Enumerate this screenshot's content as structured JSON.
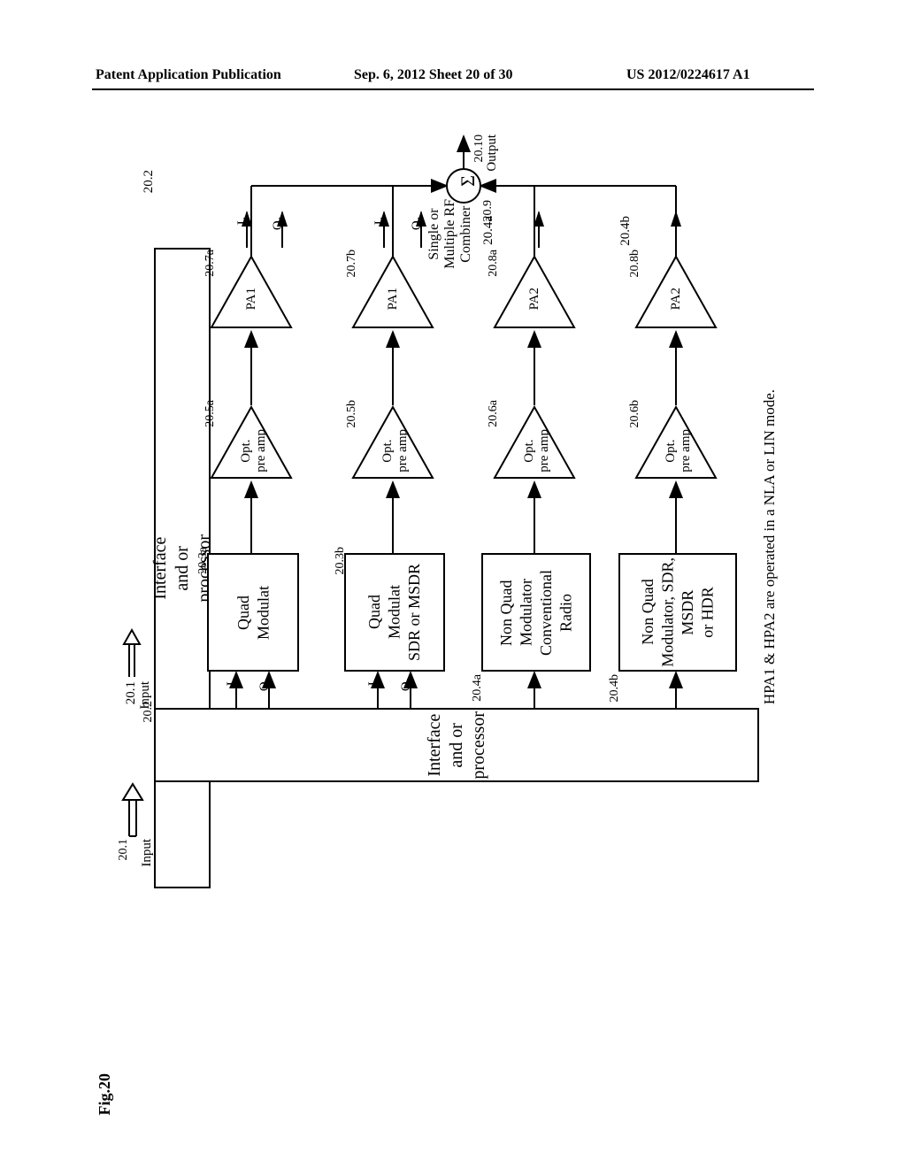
{
  "header": {
    "left": "Patent Application Publication",
    "center": "Sep. 6, 2012  Sheet 20 of 30",
    "right": "US 2012/0224617 A1"
  },
  "input": {
    "ref": "20.1",
    "label": "Input"
  },
  "processor": {
    "ref": "20.2",
    "label": "Interface\nand or\nprocessor"
  },
  "signals": {
    "i1": "I₁",
    "q1": "Q₁"
  },
  "mod": {
    "a": {
      "ref": "20.3a",
      "label": "Quad\nModulat"
    },
    "b": {
      "ref": "20.3b",
      "label": "Quad\nModulat\nSDR or MSDR"
    },
    "c": {
      "ref": "20.4a",
      "label": "Non Quad\nModulator\nConventional\nRadio"
    },
    "d": {
      "ref": "20.4b",
      "label": "Non Quad\nModulator, SDR,\nMSDR\nor HDR"
    }
  },
  "preamp": {
    "a": {
      "ref": "20.5a",
      "label": "Opt.\npre amp"
    },
    "b": {
      "ref": "20.5b",
      "label": "Opt.\npre amp"
    },
    "c": {
      "ref": "20.6a",
      "label": "Opt.\npre amp"
    },
    "d": {
      "ref": "20.6b",
      "label": "Opt.\npre amp"
    }
  },
  "pa": {
    "a": {
      "ref": "20.7a",
      "label": "PA1"
    },
    "b": {
      "ref": "20.7b",
      "label": "PA1"
    },
    "c": {
      "ref": "20.8a",
      "label": "PA2"
    },
    "d": {
      "ref": "20.8b",
      "label": "PA2"
    }
  },
  "combiner": {
    "ref": "20.9",
    "label": "Single or\nMultiple RF\nCombiner",
    "sigma": "Σ"
  },
  "output": {
    "ref": "20.10",
    "label": "Output"
  },
  "note": "HPA1 & HPA2 are operated in a NLA or LIN  mode.",
  "figno": "Fig.20"
}
